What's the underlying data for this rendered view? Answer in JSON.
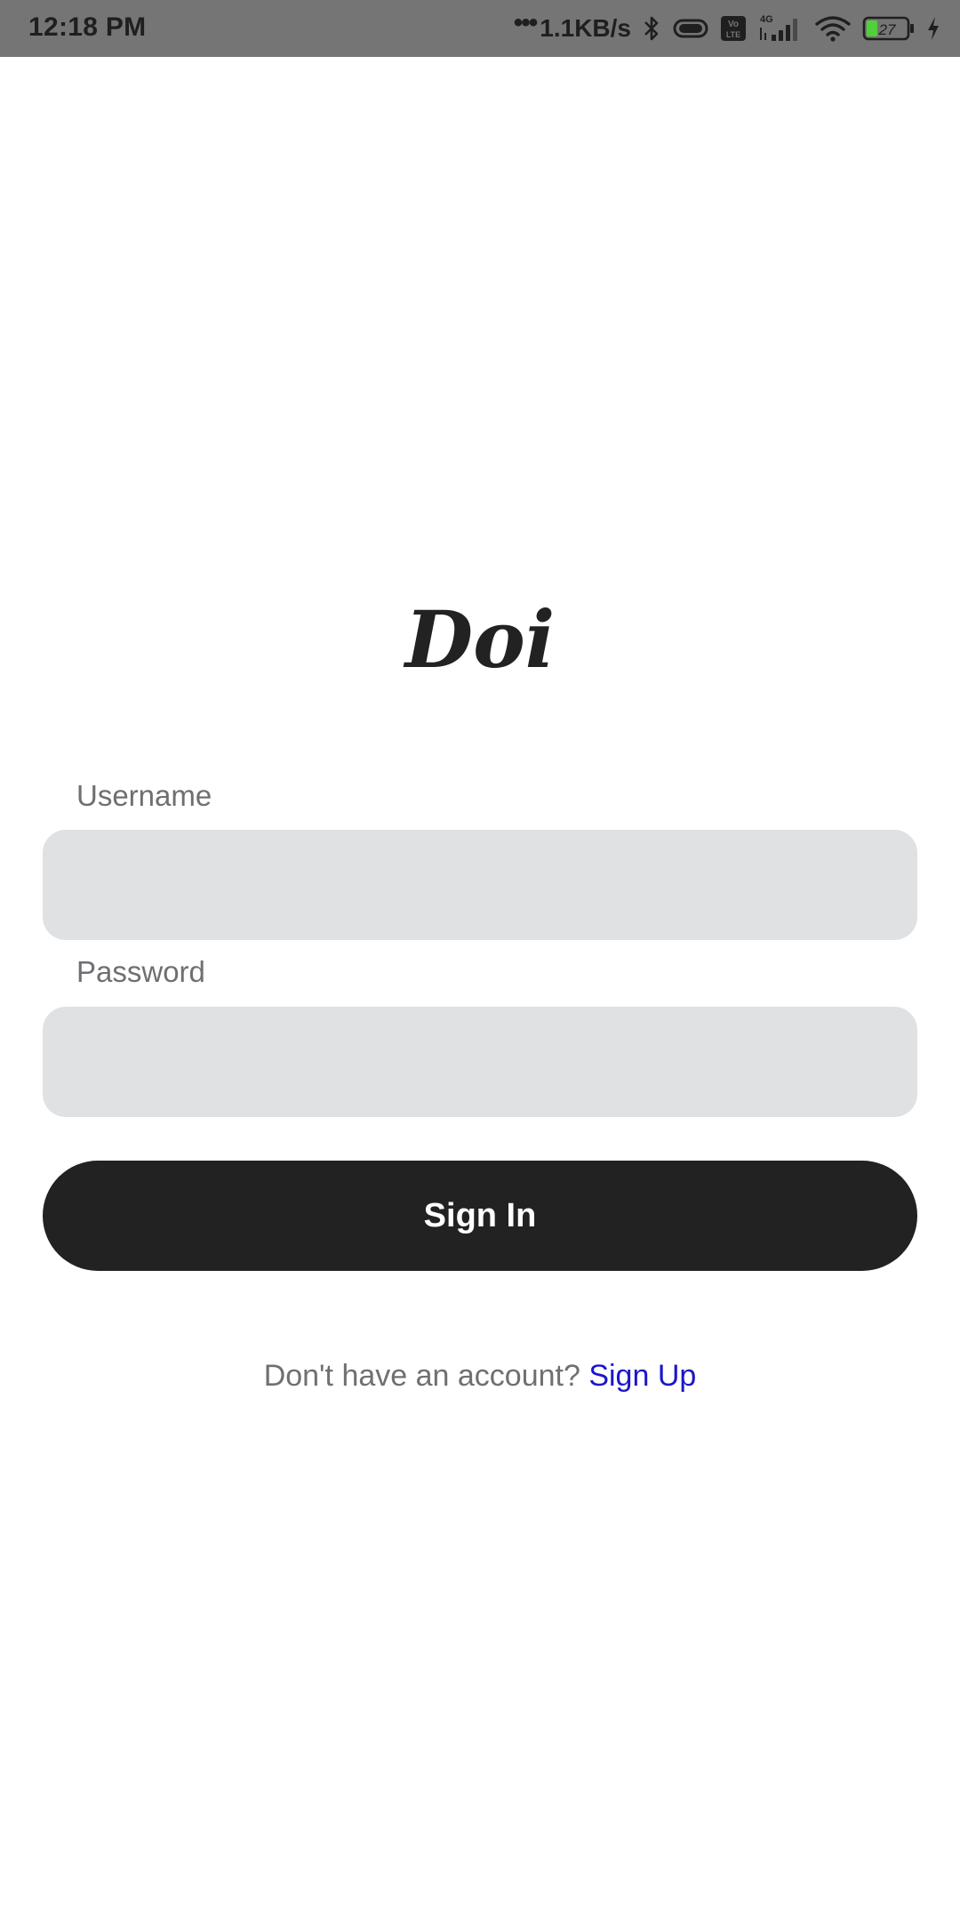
{
  "status_bar": {
    "time": "12:18 PM",
    "network_speed": "1.1KB/s",
    "network_type": "4G",
    "volte_label_top": "Vo",
    "volte_label_bottom": "LTE",
    "battery_level": "27",
    "icons": [
      "dots-icon",
      "bluetooth-icon",
      "vibrate-icon",
      "volte-icon",
      "signal-icon",
      "wifi-icon",
      "battery-icon",
      "charging-icon"
    ]
  },
  "app": {
    "logo_text": "Doi"
  },
  "form": {
    "username_label": "Username",
    "username_value": "",
    "password_label": "Password",
    "password_value": "",
    "sign_in_label": "Sign In"
  },
  "footer": {
    "prompt_text": "Don't have an account?",
    "sign_up_label": "Sign Up"
  },
  "colors": {
    "status_bar_bg": "#757575",
    "input_bg": "#e0e1e3",
    "button_bg": "#222222",
    "link": "#1c16c9"
  }
}
